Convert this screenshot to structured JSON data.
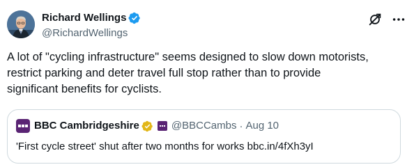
{
  "author": {
    "display_name": "Richard Wellings",
    "handle": "@RichardWellings",
    "verified_color": "#1d9bf0",
    "avatar_icon": "person-avatar"
  },
  "tweet": {
    "text": "A lot of \"cycling infrastructure\" seems designed to slow down motorists,\nrestrict parking and deter travel full stop rather than to provide\nsignificant benefits for cyclists."
  },
  "header_icons": {
    "grok": "grok-icon",
    "more": "more-dots-icon"
  },
  "quote": {
    "display_name": "BBC Cambridgeshire",
    "handle": "@BBCCambs",
    "separator": "·",
    "date": "Aug 10",
    "text": "'First cycle street' shut after two months for works bbc.in/4fXh3yI",
    "logo_icon": "bbc-logo",
    "verified_color": "#e2b719",
    "brand_color": "#5a2474"
  },
  "colors": {
    "text_primary": "#0f1419",
    "text_secondary": "#536471",
    "border": "#cfd9de"
  }
}
